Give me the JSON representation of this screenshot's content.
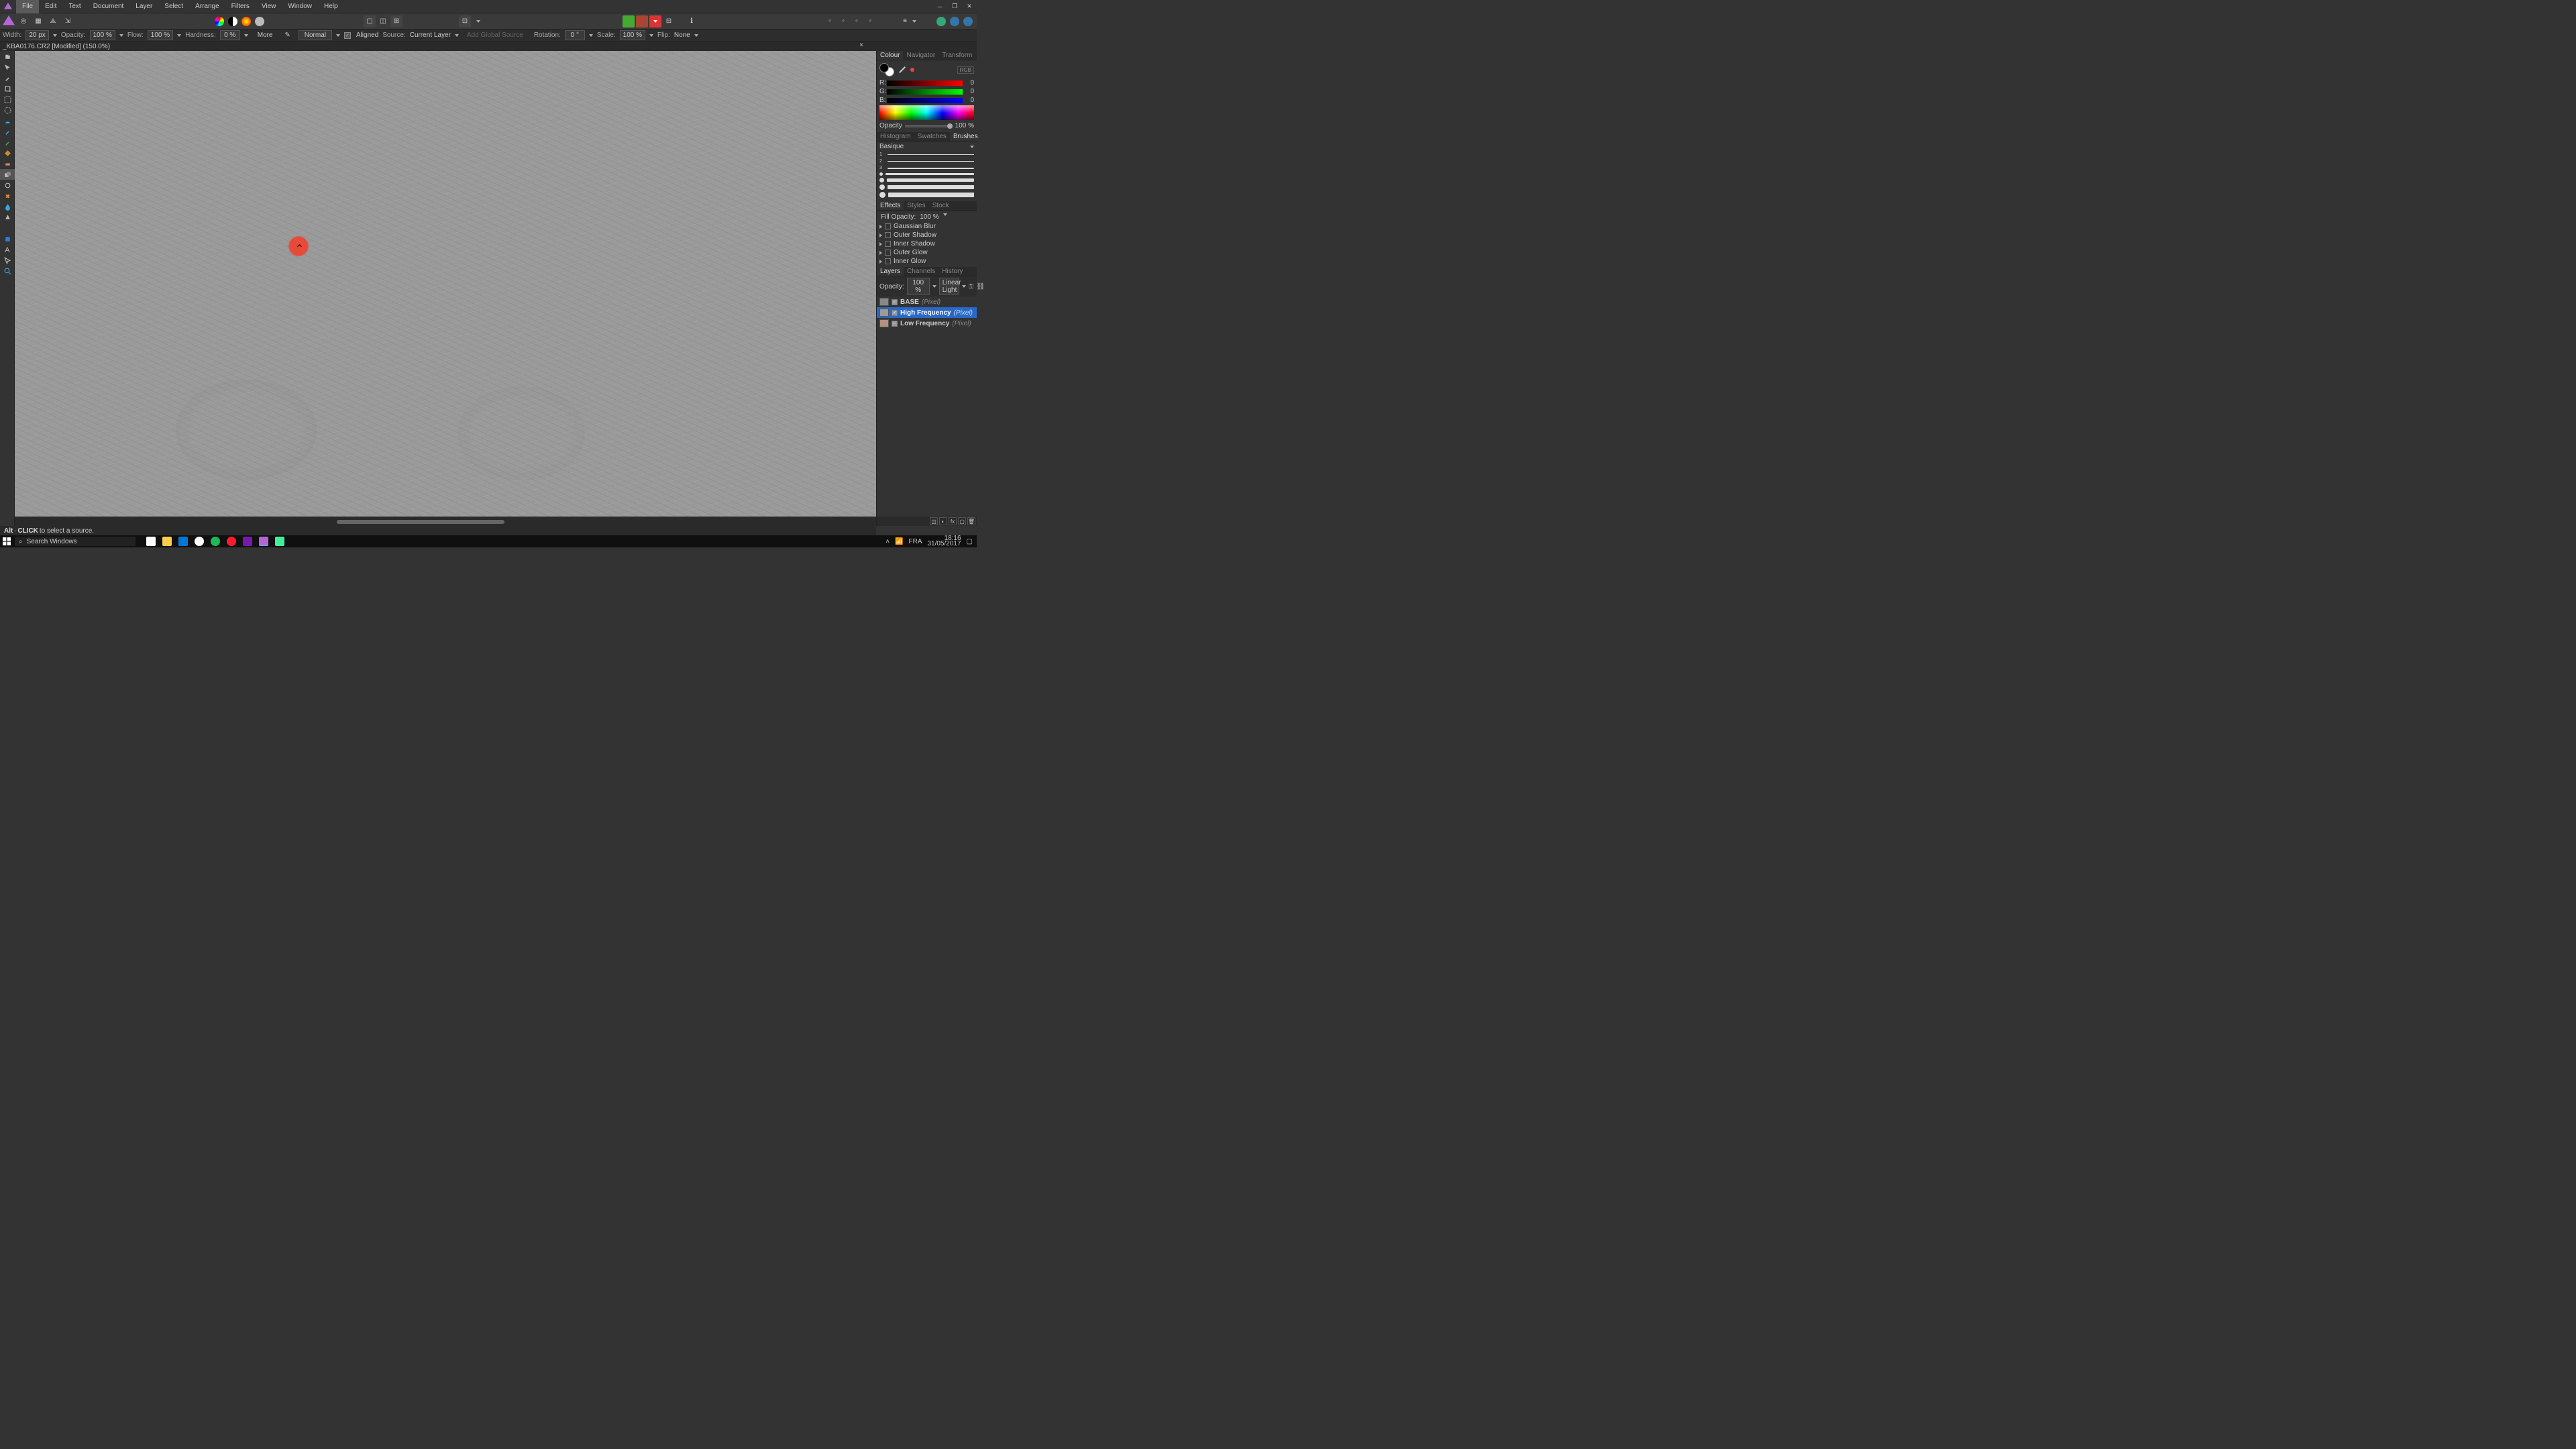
{
  "menubar": {
    "items": [
      "File",
      "Edit",
      "Text",
      "Document",
      "Layer",
      "Select",
      "Arrange",
      "Filters",
      "View",
      "Window",
      "Help"
    ]
  },
  "options": {
    "width_lbl": "Width:",
    "width_val": "20 px",
    "opacity_lbl": "Opacity:",
    "opacity_val": "100 %",
    "flow_lbl": "Flow:",
    "flow_val": "100 %",
    "hardness_lbl": "Hardness:",
    "hardness_val": "0 %",
    "more": "More",
    "blend": "Normal",
    "aligned": "Aligned",
    "source_lbl": "Source:",
    "source_val": "Current Layer",
    "global_src": "Add Global Source",
    "rotation_lbl": "Rotation:",
    "rotation_val": "0 °",
    "scale_lbl": "Scale:",
    "scale_val": "100 %",
    "flip_lbl": "Flip:",
    "flip_val": "None"
  },
  "doc_tab": "_KBA0176.CR2 [Modified] (150.0%)",
  "color_panel": {
    "tabs": [
      "Colour",
      "Navigator",
      "Transform"
    ],
    "mode": "RGB",
    "r_lbl": "R:",
    "g_lbl": "G:",
    "b_lbl": "B:",
    "r_val": "0",
    "g_val": "0",
    "b_val": "0",
    "opacity_lbl": "Opacity",
    "opacity_val": "100 %"
  },
  "brushes": {
    "tabs": [
      "Histogram",
      "Swatches",
      "Brushes"
    ],
    "header": "Basique",
    "rows": [
      "1",
      "2",
      "3",
      " ",
      " ",
      " "
    ]
  },
  "effects": {
    "tabs": [
      "Effects",
      "Styles",
      "Stock"
    ],
    "fill_opacity_lbl": "Fill Opacity:",
    "fill_opacity_val": "100 %",
    "items": [
      "Gaussian Blur",
      "Outer Shadow",
      "Inner Shadow",
      "Outer Glow",
      "Inner Glow"
    ]
  },
  "layers": {
    "tabs": [
      "Layers",
      "Channels",
      "History"
    ],
    "opacity_lbl": "Opacity:",
    "opacity_val": "100 %",
    "blend": "Linear Light",
    "rows": [
      {
        "name": "BASE",
        "type": "(Pixel)",
        "sel": false,
        "thumb": "img"
      },
      {
        "name": "High Frequency",
        "type": "(Pixel)",
        "sel": true,
        "thumb": "hf"
      },
      {
        "name": "Low Frequency",
        "type": "(Pixel)",
        "sel": false,
        "thumb": "lf"
      }
    ]
  },
  "status": {
    "pre": "Alt",
    "mid": "CLICK",
    "post": " to select a source."
  },
  "taskbar": {
    "search_ph": "Search Windows",
    "lang": "FRA",
    "time": "18:16",
    "date": "31/05/2017"
  }
}
